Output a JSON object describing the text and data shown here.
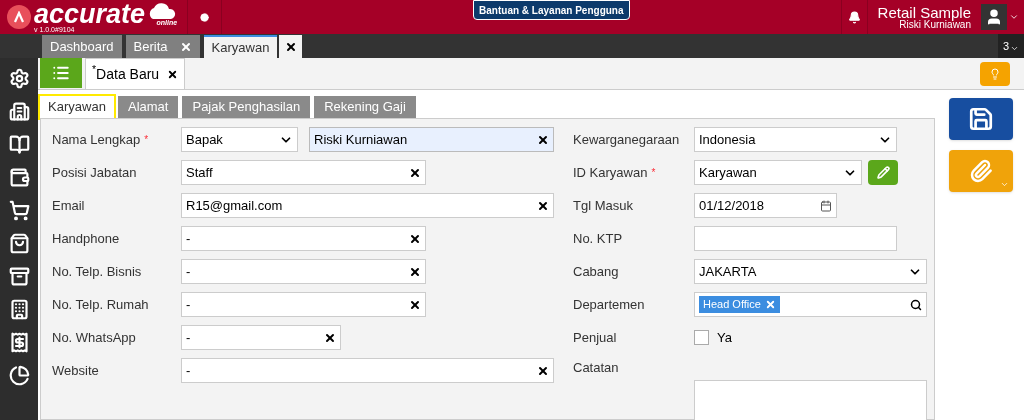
{
  "header": {
    "logo_text": "accurate",
    "logo_sub": "online",
    "version": "v 1.0.0#9104",
    "help_button": "Bantuan & Layanan Pengguna",
    "company": "Retail Sample",
    "user": "Riski Kurniawan"
  },
  "window_tabs": [
    {
      "label": "Dashboard",
      "closable": false,
      "selected": false
    },
    {
      "label": "Berita",
      "closable": true,
      "selected": false
    },
    {
      "label": "Karyawan",
      "closable": true,
      "selected": true
    }
  ],
  "tab_count": "3",
  "document_tab": {
    "marker": "*",
    "label": "Data Baru"
  },
  "form_tabs": [
    {
      "label": "Karyawan",
      "selected": true
    },
    {
      "label": "Alamat",
      "selected": false
    },
    {
      "label": "Pajak Penghasilan",
      "selected": false
    },
    {
      "label": "Rekening Gaji",
      "selected": false
    }
  ],
  "left_fields": [
    {
      "label": "Nama Lengkap",
      "required": true,
      "kind": "name",
      "salutation": "Bapak",
      "value": "Riski Kurniawan"
    },
    {
      "label": "Posisi Jabatan",
      "required": false,
      "kind": "text",
      "value": "Staff"
    },
    {
      "label": "Email",
      "required": false,
      "kind": "text",
      "value": "R15@gmail.com"
    },
    {
      "label": "Handphone",
      "required": false,
      "kind": "text",
      "value": "-"
    },
    {
      "label": "No. Telp. Bisnis",
      "required": false,
      "kind": "text",
      "value": "-"
    },
    {
      "label": "No. Telp. Rumah",
      "required": false,
      "kind": "text",
      "value": "-"
    },
    {
      "label": "No. WhatsApp",
      "required": false,
      "kind": "text",
      "value": "-"
    },
    {
      "label": "Website",
      "required": false,
      "kind": "text",
      "value": "-"
    }
  ],
  "right_fields": [
    {
      "label": "Kewarganegaraan",
      "required": false,
      "kind": "select",
      "value": "Indonesia"
    },
    {
      "label": "ID Karyawan",
      "required": true,
      "kind": "select-edit",
      "value": "Karyawan"
    },
    {
      "label": "Tgl Masuk",
      "required": false,
      "kind": "date",
      "value": "01/12/2018"
    },
    {
      "label": "No. KTP",
      "required": false,
      "kind": "plain"
    },
    {
      "label": "Cabang",
      "required": false,
      "kind": "select",
      "value": "JAKARTA"
    },
    {
      "label": "Departemen",
      "required": false,
      "kind": "tags",
      "tags": [
        "Head Office"
      ]
    },
    {
      "label": "Penjual",
      "required": false,
      "kind": "checkbox",
      "checked": false,
      "option": "Ya"
    },
    {
      "label": "Catatan",
      "required": false,
      "kind": "textarea"
    }
  ]
}
